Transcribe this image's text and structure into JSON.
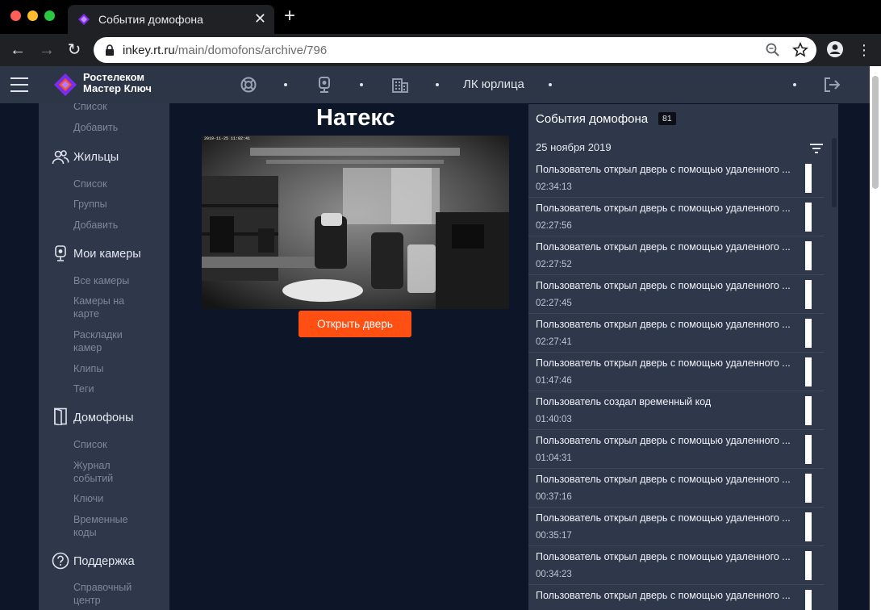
{
  "browser": {
    "tab_title": "События домофона",
    "url_host": "inkey.rt.ru",
    "url_path": "/main/domofons/archive/796"
  },
  "header": {
    "logo_line1": "Ростелеком",
    "logo_line2": "Мастер Ключ",
    "account": "ЛК юрлица"
  },
  "sidebar": {
    "top_items": [
      "Список",
      "Добавить"
    ],
    "sections": [
      {
        "title": "Жильцы",
        "icon": "people-icon",
        "items": [
          "Список",
          "Группы",
          "Добавить"
        ]
      },
      {
        "title": "Мои камеры",
        "icon": "camera-icon",
        "items": [
          "Все камеры",
          "Камеры на карте",
          "Раскладки камер",
          "Клипы",
          "Теги"
        ]
      },
      {
        "title": "Домофоны",
        "icon": "door-icon",
        "items": [
          "Список",
          "Журнал событий",
          "Ключи",
          "Временные коды"
        ]
      },
      {
        "title": "Поддержка",
        "icon": "help-icon",
        "items": [
          "Справочный центр"
        ]
      }
    ]
  },
  "main": {
    "camera_title": "Натекс",
    "camera_timestamp": "2019-11-25 11:02:41",
    "open_door_label": "Открыть дверь"
  },
  "events": {
    "title": "События домофона",
    "count": "81",
    "date": "25 ноября 2019",
    "items": [
      {
        "text": "Пользователь открыл дверь с помощью удаленного ...",
        "time": "02:34:13"
      },
      {
        "text": "Пользователь открыл дверь с помощью удаленного ...",
        "time": "02:27:56"
      },
      {
        "text": "Пользователь открыл дверь с помощью удаленного ...",
        "time": "02:27:52"
      },
      {
        "text": "Пользователь открыл дверь с помощью удаленного ...",
        "time": "02:27:45"
      },
      {
        "text": "Пользователь открыл дверь с помощью удаленного ...",
        "time": "02:27:41"
      },
      {
        "text": "Пользователь открыл дверь с помощью удаленного ...",
        "time": "01:47:46"
      },
      {
        "text": "Пользователь создал временный код",
        "time": "01:40:03"
      },
      {
        "text": "Пользователь открыл дверь с помощью удаленного ...",
        "time": "01:04:31"
      },
      {
        "text": "Пользователь открыл дверь с помощью удаленного ...",
        "time": "00:37:16"
      },
      {
        "text": "Пользователь открыл дверь с помощью удаленного ...",
        "time": "00:35:17"
      },
      {
        "text": "Пользователь открыл дверь с помощью удаленного ...",
        "time": "00:34:23"
      },
      {
        "text": "Пользователь открыл дверь с помощью удаленного ...",
        "time": ""
      }
    ]
  },
  "colors": {
    "accent": "#ff4f12",
    "header_bg": "#2d3647",
    "sidebar_bg": "#2e384a",
    "page_bg": "#0c1628"
  }
}
